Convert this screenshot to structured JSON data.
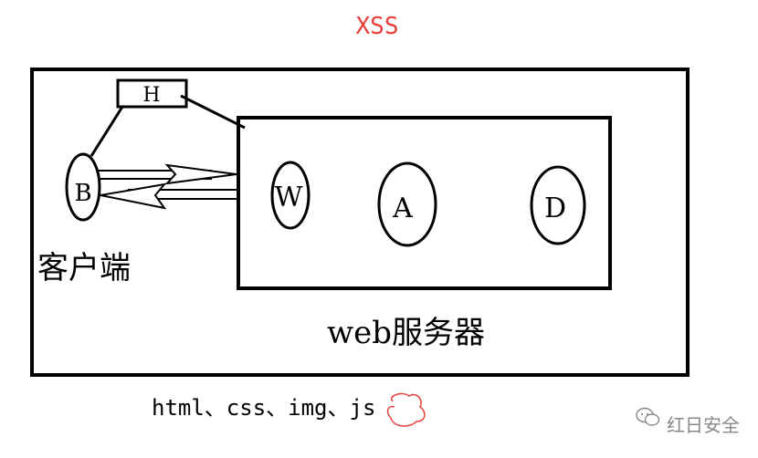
{
  "title": "XSS",
  "client": {
    "node_letter": "B",
    "label": "客户端"
  },
  "hacker": {
    "node_letter": "H"
  },
  "server": {
    "label": "web服务器",
    "nodes": [
      "W",
      "A",
      "D"
    ]
  },
  "resources_line": {
    "prefix": "html、css、img、",
    "highlighted": "js"
  },
  "watermark": {
    "text": "红日安全",
    "icon": "wechat-icon"
  },
  "colors": {
    "title": "#e8403a",
    "stroke": "#000000",
    "scribble": "#e8403a",
    "watermark": "#888888"
  }
}
